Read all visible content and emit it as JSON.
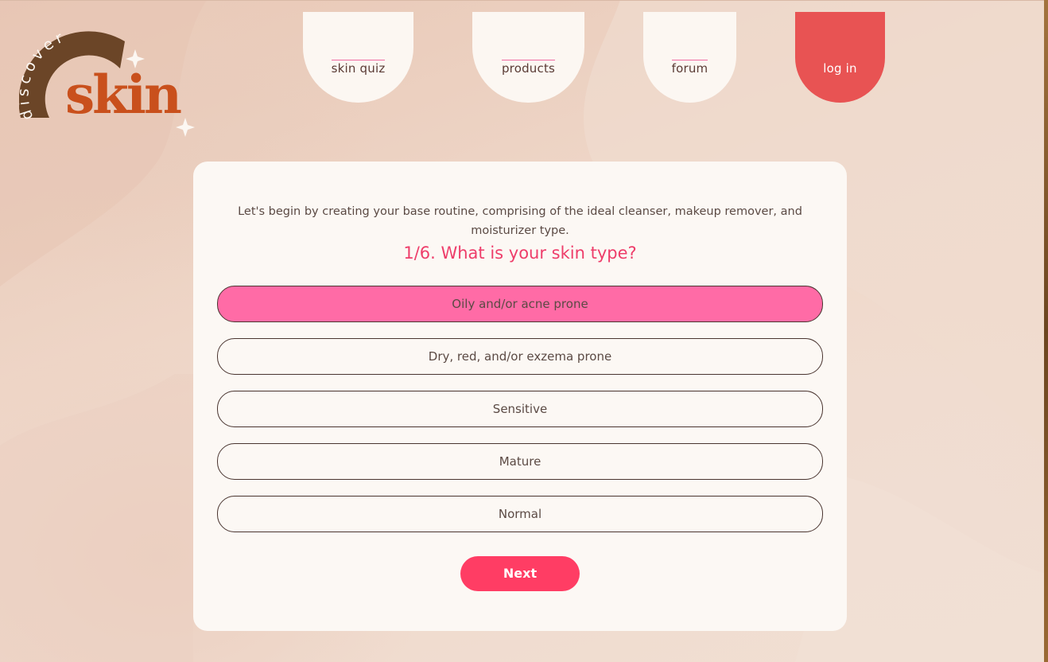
{
  "logo": {
    "arc_text": "discover",
    "wordmark": "skin"
  },
  "nav": {
    "items": [
      {
        "label": "skin quiz"
      },
      {
        "label": "products"
      },
      {
        "label": "forum"
      },
      {
        "label": "log in"
      }
    ]
  },
  "quiz": {
    "intro": "Let's begin by creating your base routine, comprising of the ideal cleanser, makeup remover, and moisturizer type.",
    "question": "1/6. What is your skin type?",
    "options": [
      {
        "label": "Oily and/or acne prone",
        "selected": true
      },
      {
        "label": "Dry, red, and/or exzema prone",
        "selected": false
      },
      {
        "label": "Sensitive",
        "selected": false
      },
      {
        "label": "Mature",
        "selected": false
      },
      {
        "label": "Normal",
        "selected": false
      }
    ],
    "next_label": "Next"
  },
  "colors": {
    "accent_pink": "#ff6ba6",
    "question_pink": "#ee3d6a",
    "next_button": "#ff3d64",
    "login_tab": "#e85353",
    "logo_brown": "#6b4527",
    "logo_orange": "#c9501c"
  }
}
